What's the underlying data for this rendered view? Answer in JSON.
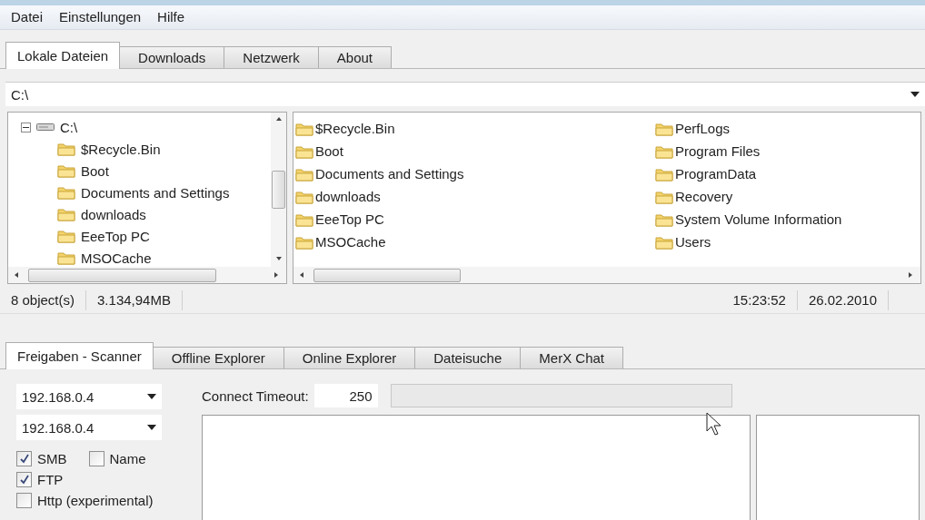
{
  "menu": [
    "Datei",
    "Einstellungen",
    "Hilfe"
  ],
  "tabs": [
    {
      "label": "Lokale Dateien",
      "selected": true
    },
    {
      "label": "Downloads",
      "selected": false
    },
    {
      "label": "Netzwerk",
      "selected": false
    },
    {
      "label": "About",
      "selected": false
    }
  ],
  "path": {
    "value": "C:\\"
  },
  "tree": {
    "label": "C:\\",
    "expanded": true,
    "children": [
      {
        "label": "$Recycle.Bin"
      },
      {
        "label": "Boot"
      },
      {
        "label": "Documents and Settings"
      },
      {
        "label": "downloads"
      },
      {
        "label": "EeeTop PC"
      },
      {
        "label": "MSOCache"
      }
    ]
  },
  "files": [
    "$Recycle.Bin",
    "Boot",
    "Documents and Settings",
    "downloads",
    "EeeTop PC",
    "MSOCache",
    "PerfLogs",
    "Program Files",
    "ProgramData",
    "Recovery",
    "System Volume Information",
    "Users"
  ],
  "status_bar": {
    "objects": "8 object(s)",
    "size": "3.134,94MB",
    "time": "15:23:52",
    "date": "26.02.2010"
  },
  "bottom_tabs": [
    {
      "label": "Freigaben - Scanner",
      "selected": true
    },
    {
      "label": "Offline Explorer",
      "selected": false
    },
    {
      "label": "Online Explorer",
      "selected": false
    },
    {
      "label": "Dateisuche",
      "selected": false
    },
    {
      "label": "MerX Chat",
      "selected": false
    }
  ],
  "ip_from": "192.168.0.4",
  "ip_to": "192.168.0.4",
  "options": [
    {
      "label": "SMB",
      "checked": true
    },
    {
      "label": "Name",
      "checked": false
    },
    {
      "label": "FTP",
      "checked": true
    },
    {
      "label": "Http (experimental)",
      "checked": false
    }
  ],
  "timeout": {
    "label": "Connect Timeout:",
    "value": "250"
  },
  "progress": {
    "level": 0
  }
}
